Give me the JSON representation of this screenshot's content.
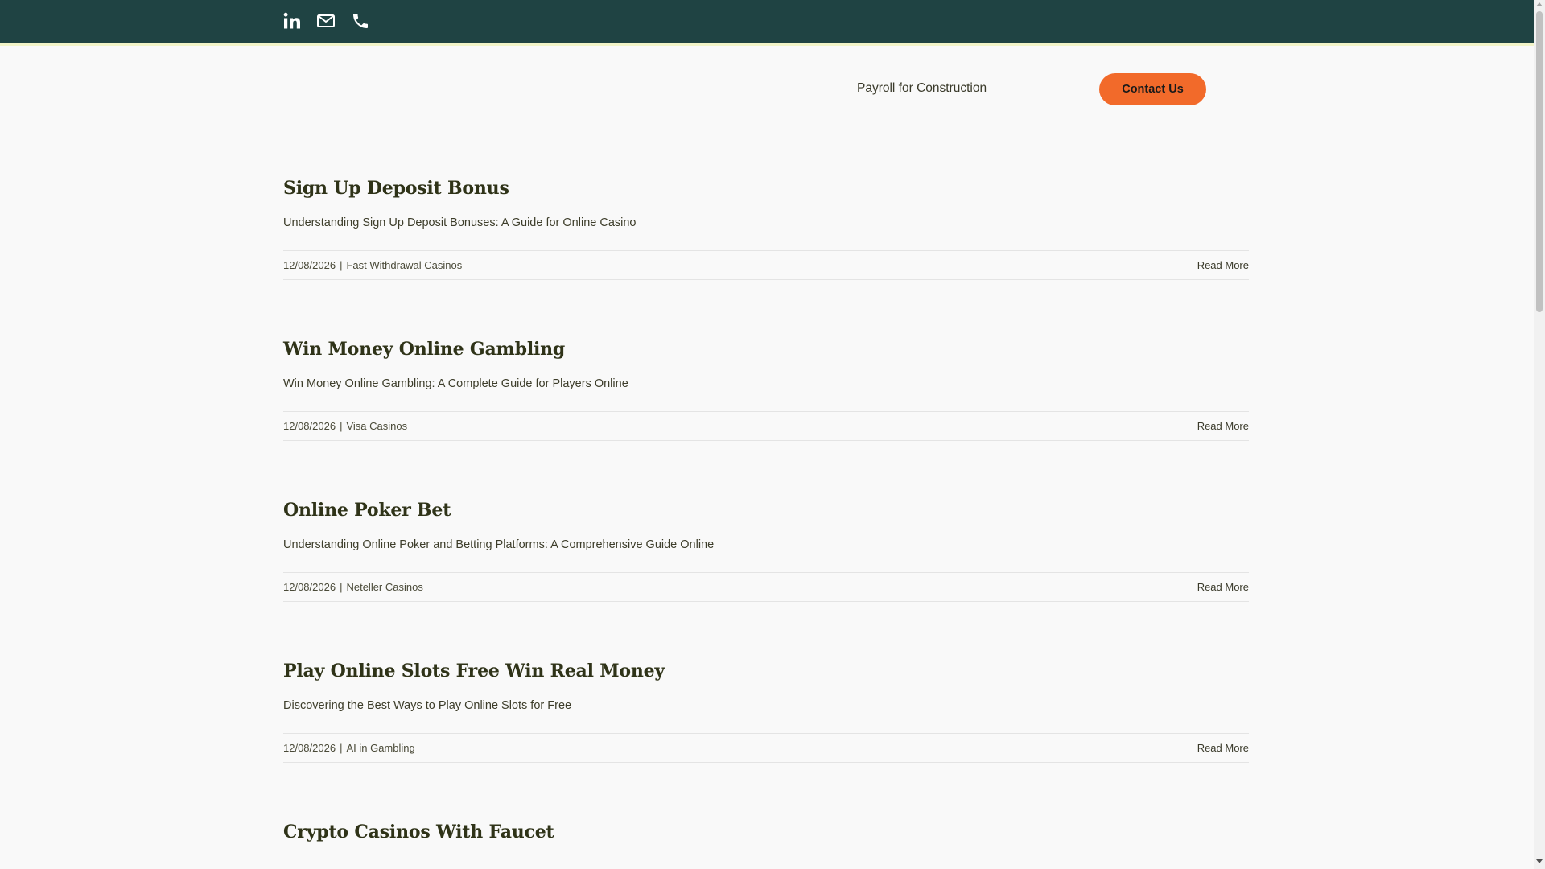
{
  "topbar": {
    "background": "#1f4343",
    "icons": [
      "linkedin-icon",
      "mail-icon",
      "phone-icon"
    ]
  },
  "nav": {
    "link_label": "Payroll for Construction",
    "contact_label": "Contact Us",
    "contact_color": "#f26a2a"
  },
  "posts": [
    {
      "title": "Sign Up Deposit Bonus",
      "excerpt": "Understanding Sign Up Deposit Bonuses: A Guide for Online Casino",
      "date": "12/08/2026",
      "category": "Fast Withdrawal Casinos",
      "read_more": "Read More"
    },
    {
      "title": "Win Money Online Gambling",
      "excerpt": "Win Money Online Gambling: A Complete Guide for Players Online",
      "date": "12/08/2026",
      "category": "Visa Casinos",
      "read_more": "Read More"
    },
    {
      "title": "Online Poker Bet",
      "excerpt": "Understanding Online Poker and Betting Platforms: A Comprehensive Guide Online",
      "date": "12/08/2026",
      "category": "Neteller Casinos",
      "read_more": "Read More"
    },
    {
      "title": "Play Online Slots Free Win Real Money",
      "excerpt": "Discovering the Best Ways to Play Online Slots for Free",
      "date": "12/08/2026",
      "category": "AI in Gambling",
      "read_more": "Read More"
    },
    {
      "title": "Crypto Casinos With Faucet"
    }
  ],
  "meta_separator": "|"
}
